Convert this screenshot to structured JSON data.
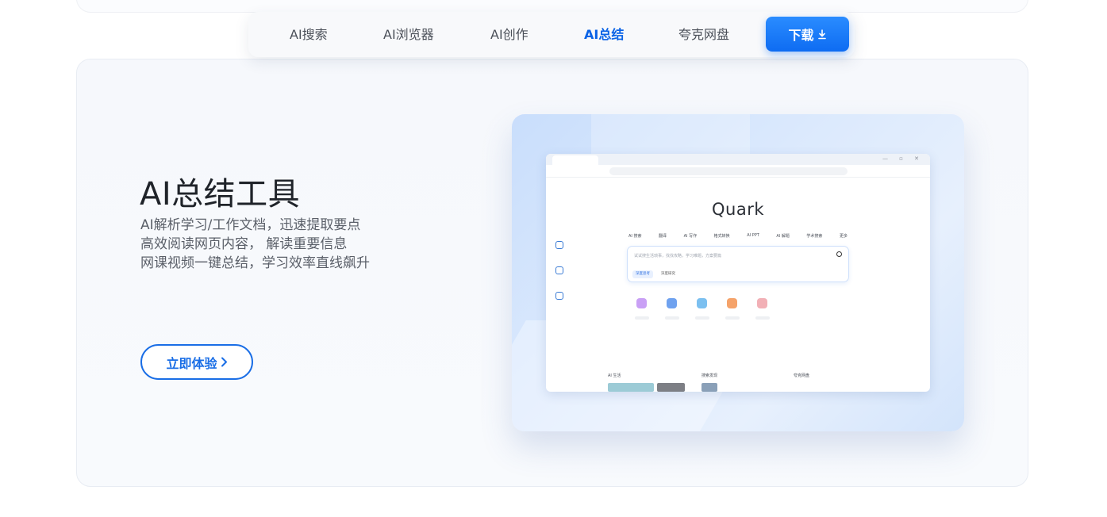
{
  "nav": {
    "items": [
      {
        "label": "AI搜索",
        "active": false
      },
      {
        "label": "AI浏览器",
        "active": false
      },
      {
        "label": "AI创作",
        "active": false
      },
      {
        "label": "AI总结",
        "active": true
      },
      {
        "label": "夸克网盘",
        "active": false
      }
    ],
    "download_label": "下载",
    "download_icon": "download-icon"
  },
  "feature": {
    "title": "AI总结工具",
    "lines": [
      "AI解析学习/工作文档，迅速提取要点",
      "高效阅读网页内容， 解读重要信息",
      "网课视频一键总结，学习效率直线飙升"
    ],
    "cta_label": "立即体验",
    "cta_icon": "chevron-right-icon"
  },
  "screenshot": {
    "logo": "Quark",
    "chips": [
      "AI 搜索",
      "翻译",
      "AI 写作",
      "格式转换",
      "AI PPT",
      "AI 解题",
      "学术搜索",
      "更多"
    ],
    "search_placeholder": "试试搜生活琐事，找找攻略，学习难题，方案要篇",
    "tools": [
      "深度思考",
      "深度研究"
    ],
    "sections": [
      "AI 生活",
      "搜索发现",
      "夸克网盘"
    ]
  },
  "colors": {
    "accent": "#0a63e6",
    "download_bg": "#1677ff",
    "text_dark": "#1f2329",
    "text_body": "#5a5f68"
  }
}
